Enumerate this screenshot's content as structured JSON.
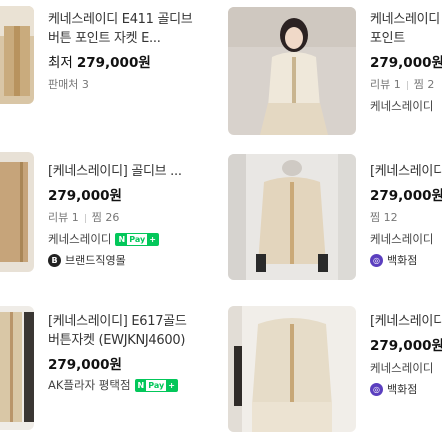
{
  "products": [
    {
      "title": "케네스레이디 E411 골디브 버튼 포인트 자켓 E...",
      "price_prefix": "최저",
      "price": "279,000원",
      "meta": [
        "판매처 3"
      ]
    },
    {
      "title": "케네스레이디 골디브 버튼 포인트",
      "price": "279,000원",
      "meta": [
        "리뷰 1",
        "찜 2"
      ],
      "mall": "케네스레이디"
    },
    {
      "title": "[케네스레이디] 골디브 ...",
      "price": "279,000원",
      "meta": [
        "리뷰 1",
        "찜 26"
      ],
      "mall": "케네스레이디",
      "badge": "브랜드직영몰"
    },
    {
      "title": "[케네스레이디",
      "price": "279,000원",
      "meta": [
        "찜 12"
      ],
      "mall": "케네스레이디",
      "badge": "백화점"
    },
    {
      "title": "[케네스레이디] E617골드 버튼자켓 (EWJKNJ4600)",
      "price": "279,000원",
      "mall": "AK플라자 평택점"
    },
    {
      "title": "[케네스레이디",
      "price": "279,000원",
      "mall": "케네스레이디",
      "badge": "백화점"
    }
  ],
  "npay": {
    "n": "N",
    "pay": "Pay",
    "plus": "+"
  },
  "icons": {
    "brand": "brand-mall-icon",
    "dept": "department-store-icon"
  },
  "colors": {
    "npay_green": "#03c75a",
    "dept_purple": "#5b3fbf"
  }
}
